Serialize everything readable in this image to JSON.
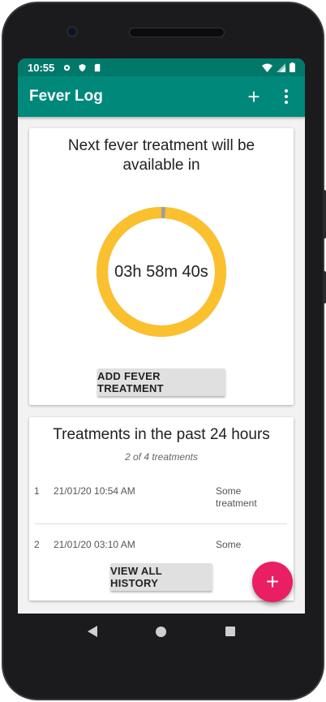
{
  "statusbar": {
    "time": "10:55"
  },
  "appbar": {
    "title": "Fever Log",
    "add_icon": "+",
    "more_icon": "more-vert"
  },
  "countdown_card": {
    "title": "Next fever treatment will be available in",
    "remaining": "03h 58m 40s",
    "progress_remaining": 0.99,
    "ring_color": "#fbc02d",
    "add_button_label": "ADD FEVER TREATMENT"
  },
  "history_card": {
    "title": "Treatments in the past 24 hours",
    "subtitle": "2 of 4 treatments",
    "rows": [
      {
        "index": "1",
        "date": "21/01/20 10:54 AM",
        "description": "Some treatment"
      },
      {
        "index": "2",
        "date": "21/01/20 03:10 AM",
        "description": "Some"
      }
    ],
    "view_all_label": "VIEW ALL HISTORY"
  },
  "fab": {
    "label": "+"
  },
  "colors": {
    "primary": "#00897b",
    "primary_dark": "#00796b",
    "accent": "#e91e63"
  }
}
